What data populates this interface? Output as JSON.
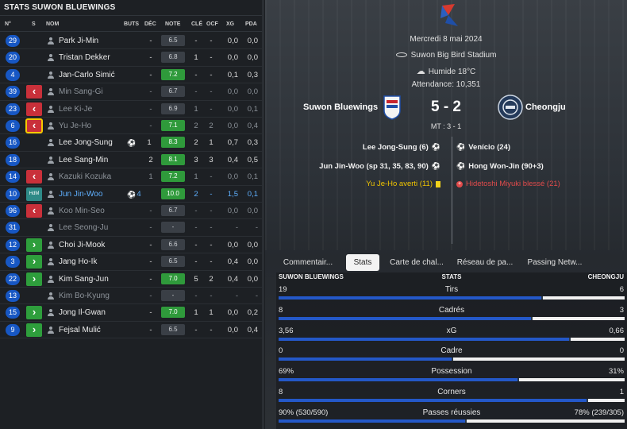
{
  "left_panel": {
    "title": "STATS SUWON BLUEWINGS",
    "columns": {
      "num": "N°",
      "s": "S",
      "nom": "NOM",
      "buts": "BUTS",
      "dec": "DÉC",
      "note": "NOTE",
      "cle": "CLÉ",
      "ocf": "OCF",
      "xg": "XG",
      "pda": "PDA"
    },
    "players": [
      {
        "num": "29",
        "sub": "",
        "name": "Park Ji-Min",
        "buts": "",
        "dec": "-",
        "note": "6.5",
        "note_color": "grey",
        "cle": "-",
        "ocf": "-",
        "xg": "0,0",
        "pda": "0,0",
        "state": ""
      },
      {
        "num": "20",
        "sub": "",
        "name": "Tristan Dekker",
        "buts": "",
        "dec": "-",
        "note": "6.8",
        "note_color": "grey",
        "cle": "1",
        "ocf": "-",
        "xg": "0,0",
        "pda": "0,0",
        "state": ""
      },
      {
        "num": "4",
        "sub": "",
        "name": "Jan-Carlo Simić",
        "buts": "",
        "dec": "-",
        "note": "7.2",
        "note_color": "green",
        "cle": "-",
        "ocf": "-",
        "xg": "0,1",
        "pda": "0,3",
        "state": ""
      },
      {
        "num": "39",
        "sub": "out",
        "name": "Min Sang-Gi",
        "buts": "",
        "dec": "-",
        "note": "6.7",
        "note_color": "grey",
        "cle": "-",
        "ocf": "-",
        "xg": "0,0",
        "pda": "0,0",
        "state": "dim"
      },
      {
        "num": "23",
        "sub": "out",
        "name": "Lee Ki-Je",
        "buts": "",
        "dec": "-",
        "note": "6.9",
        "note_color": "grey",
        "cle": "1",
        "ocf": "-",
        "xg": "0,0",
        "pda": "0,1",
        "state": "dim"
      },
      {
        "num": "6",
        "sub": "out-sel",
        "name": "Yu Je-Ho",
        "buts": "",
        "dec": "-",
        "note": "7.1",
        "note_color": "green",
        "cle": "2",
        "ocf": "2",
        "xg": "0,0",
        "pda": "0,4",
        "state": "dim"
      },
      {
        "num": "16",
        "sub": "",
        "name": "Lee Jong-Sung",
        "buts": "1",
        "dec": "",
        "note": "8.3",
        "note_color": "green",
        "cle": "2",
        "ocf": "1",
        "xg": "0,7",
        "pda": "0,3",
        "state": "",
        "goal": true
      },
      {
        "num": "18",
        "sub": "",
        "name": "Lee Sang-Min",
        "buts": "",
        "dec": "2",
        "note": "8.1",
        "note_color": "green",
        "cle": "3",
        "ocf": "3",
        "xg": "0,4",
        "pda": "0,5",
        "state": ""
      },
      {
        "num": "14",
        "sub": "out",
        "name": "Kazuki Kozuka",
        "buts": "",
        "dec": "1",
        "note": "7.2",
        "note_color": "green",
        "cle": "1",
        "ocf": "-",
        "xg": "0,0",
        "pda": "0,1",
        "state": "dim"
      },
      {
        "num": "10",
        "sub": "hdm",
        "name": "Jun Jin-Woo",
        "buts": "4",
        "dec": "",
        "note": "10.0",
        "note_color": "green",
        "cle": "2",
        "ocf": "-",
        "xg": "1,5",
        "pda": "0,1",
        "state": "sel",
        "goal": true
      },
      {
        "num": "96",
        "sub": "out",
        "name": "Koo Min-Seo",
        "buts": "",
        "dec": "-",
        "note": "6.7",
        "note_color": "grey",
        "cle": "-",
        "ocf": "-",
        "xg": "0,0",
        "pda": "0,0",
        "state": "dim"
      },
      {
        "num": "31",
        "sub": "",
        "name": "Lee Seong-Ju",
        "buts": "",
        "dec": "-",
        "note": "-",
        "note_color": "grey",
        "cle": "-",
        "ocf": "-",
        "xg": "-",
        "pda": "-",
        "state": "dim"
      },
      {
        "num": "12",
        "sub": "in",
        "name": "Choi Ji-Mook",
        "buts": "",
        "dec": "-",
        "note": "6.6",
        "note_color": "grey",
        "cle": "-",
        "ocf": "-",
        "xg": "0,0",
        "pda": "0,0",
        "state": ""
      },
      {
        "num": "3",
        "sub": "in",
        "name": "Jang Ho-Ik",
        "buts": "",
        "dec": "-",
        "note": "6.5",
        "note_color": "grey",
        "cle": "-",
        "ocf": "-",
        "xg": "0,4",
        "pda": "0,0",
        "state": ""
      },
      {
        "num": "22",
        "sub": "in",
        "name": "Kim Sang-Jun",
        "buts": "",
        "dec": "-",
        "note": "7.0",
        "note_color": "green",
        "cle": "5",
        "ocf": "2",
        "xg": "0,4",
        "pda": "0,0",
        "state": ""
      },
      {
        "num": "13",
        "sub": "",
        "name": "Kim Bo-Kyung",
        "buts": "",
        "dec": "-",
        "note": "-",
        "note_color": "grey",
        "cle": "-",
        "ocf": "-",
        "xg": "-",
        "pda": "-",
        "state": "dim"
      },
      {
        "num": "15",
        "sub": "in",
        "name": "Jong Il-Gwan",
        "buts": "",
        "dec": "-",
        "note": "7.0",
        "note_color": "green",
        "cle": "1",
        "ocf": "1",
        "xg": "0,0",
        "pda": "0,2",
        "state": ""
      },
      {
        "num": "9",
        "sub": "in",
        "name": "Fejsal Mulić",
        "buts": "",
        "dec": "-",
        "note": "6.5",
        "note_color": "grey",
        "cle": "-",
        "ocf": "-",
        "xg": "0,0",
        "pda": "0,4",
        "state": ""
      }
    ],
    "hdm_label": "HdM"
  },
  "match": {
    "date": "Mercredi 8 mai 2024",
    "stadium": "Suwon Big Bird Stadium",
    "weather": "Humide 18°C",
    "attendance": "Attendance: 10,351",
    "home_team": "Suwon Bluewings",
    "away_team": "Cheongju",
    "score": "5 - 2",
    "half_time": "MT : 3 - 1",
    "home_events": [
      {
        "text": "Lee Jong-Sung (6)",
        "type": "goal"
      },
      {
        "text": "Jun Jin-Woo (sp 31, 35, 83, 90)",
        "type": "goal"
      },
      {
        "text": "Yu Je-Ho averti (11)",
        "type": "yellow"
      }
    ],
    "away_events": [
      {
        "text": "Venício (24)",
        "type": "goal"
      },
      {
        "text": "Hong Won-Jin (90+3)",
        "type": "goal"
      },
      {
        "text": "Hidetoshi Miyuki blessé (21)",
        "type": "injury"
      }
    ]
  },
  "tabs": [
    "Commentair...",
    "Stats",
    "Carte de chal...",
    "Réseau de pa...",
    "Passing Netw..."
  ],
  "active_tab": "Stats",
  "stats": {
    "home_header": "SUWON BLUEWINGS",
    "center_header": "STATS",
    "away_header": "CHEONGJU",
    "rows": [
      {
        "label": "Tirs",
        "home": "19",
        "away": "6",
        "home_share": 0.76
      },
      {
        "label": "Cadrés",
        "home": "8",
        "away": "3",
        "home_share": 0.73
      },
      {
        "label": "xG",
        "home": "3,56",
        "away": "0,66",
        "home_share": 0.84
      },
      {
        "label": "Cadre",
        "home": "0",
        "away": "0",
        "home_share": 0.5
      },
      {
        "label": "Possession",
        "home": "69%",
        "away": "31%",
        "home_share": 0.69
      },
      {
        "label": "Corners",
        "home": "8",
        "away": "1",
        "home_share": 0.89
      },
      {
        "label": "Passes réussies",
        "home": "90% (530/590)",
        "away": "78% (239/305)",
        "home_share": 0.54
      }
    ]
  },
  "colors": {
    "home_blue": "#2458c8",
    "away_white": "#f1f1f1",
    "note_green": "#2f9a3b",
    "sub_out": "#c9303a",
    "sub_in": "#2e9e3c",
    "selected_name": "#5fb0ff"
  }
}
